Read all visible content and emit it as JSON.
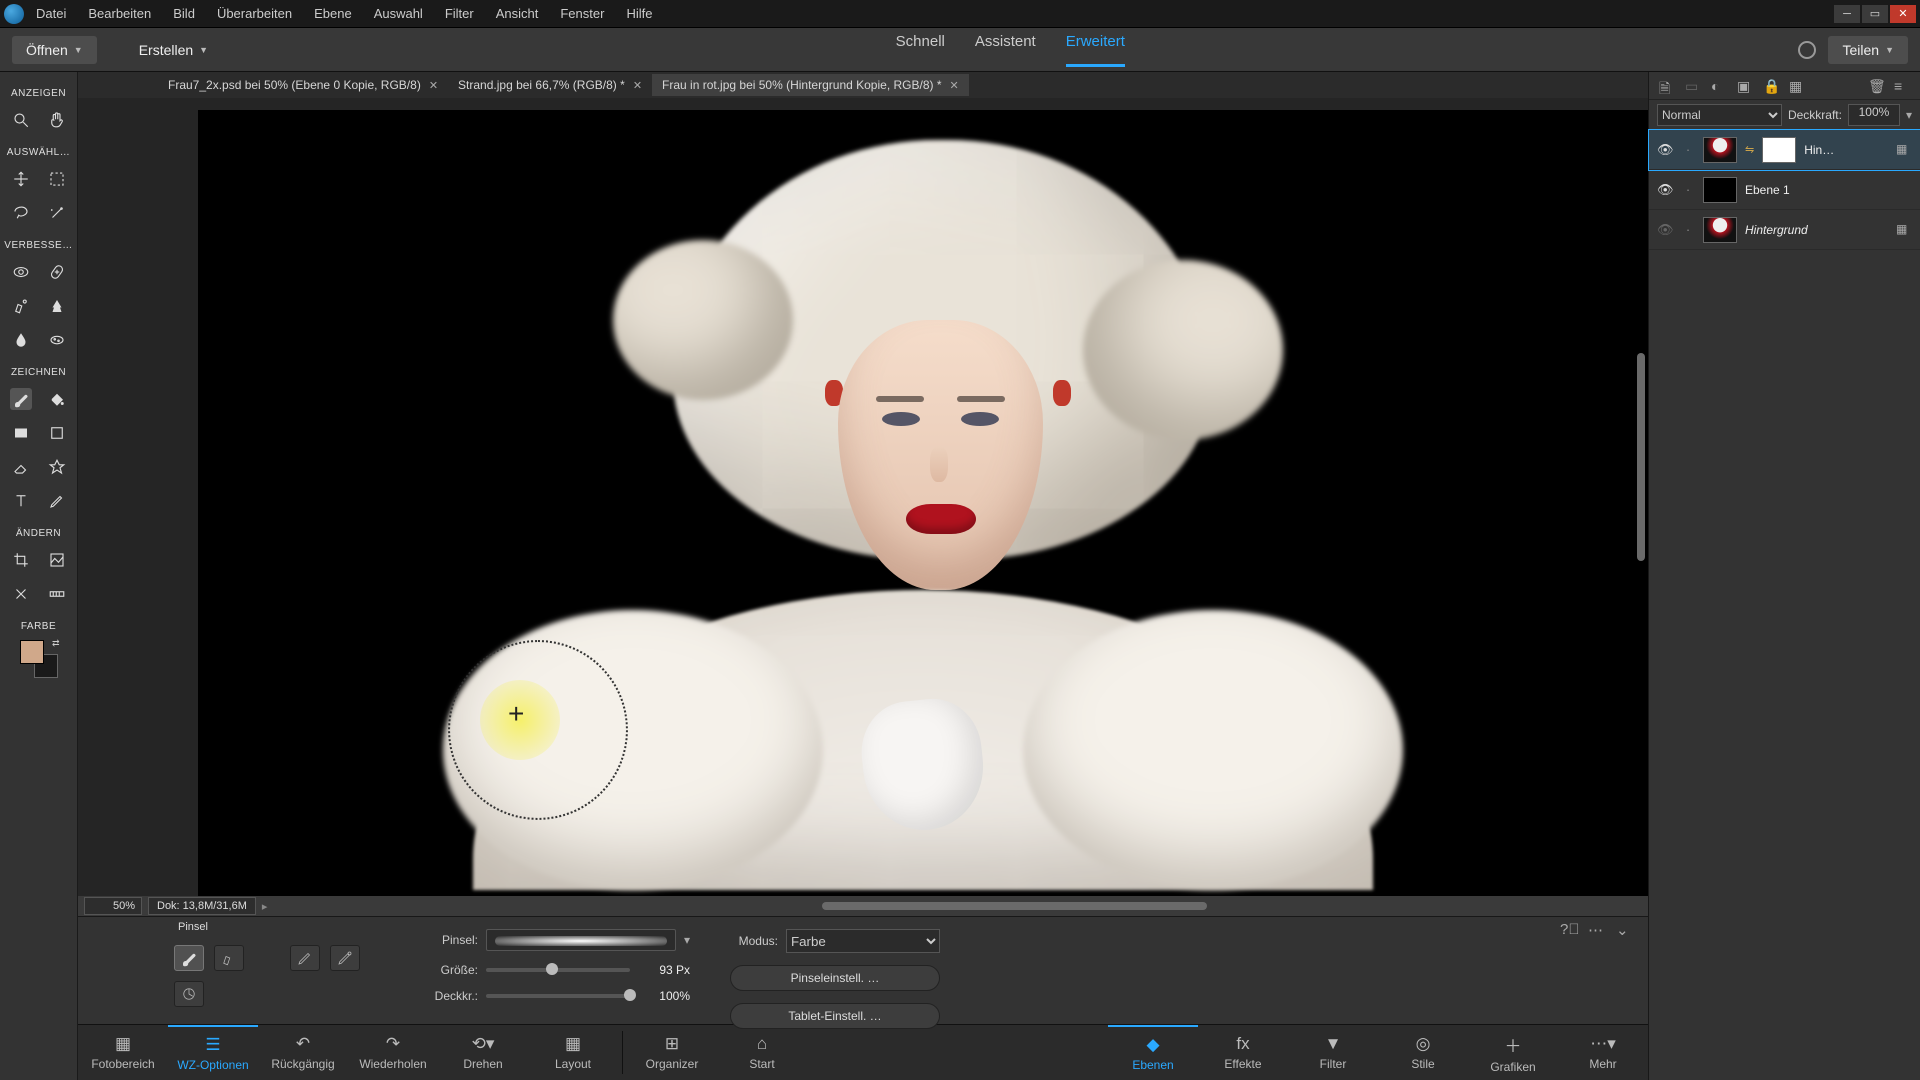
{
  "menu": {
    "items": [
      "Datei",
      "Bearbeiten",
      "Bild",
      "Überarbeiten",
      "Ebene",
      "Auswahl",
      "Filter",
      "Ansicht",
      "Fenster",
      "Hilfe"
    ]
  },
  "actions": {
    "open": "Öffnen",
    "create": "Erstellen",
    "modes": {
      "quick": "Schnell",
      "assistant": "Assistent",
      "advanced": "Erweitert"
    },
    "share": "Teilen"
  },
  "docs": [
    {
      "label": "Frau7_2x.psd bei 50% (Ebene 0 Kopie, RGB/8)",
      "active": false
    },
    {
      "label": "Strand.jpg bei 66,7% (RGB/8) *",
      "active": false
    },
    {
      "label": "Frau in rot.jpg bei 50% (Hintergrund Kopie, RGB/8) *",
      "active": true
    }
  ],
  "leftbar": {
    "sections": {
      "view": "ANZEIGEN",
      "select": "AUSWÄHL…",
      "enhance": "VERBESSE…",
      "draw": "ZEICHNEN",
      "edit": "ÄNDERN",
      "color": "FARBE"
    }
  },
  "canvas": {
    "zoom": "50%",
    "docinfo": "Dok: 13,8M/31,6M"
  },
  "rightpanel": {
    "blend": {
      "mode": "Normal",
      "opacityLabel": "Deckkraft:",
      "opacityValue": "100%"
    },
    "layers": [
      {
        "name": "Hin…",
        "visible": true,
        "hasMask": true,
        "linked": true,
        "bg": false,
        "selected": true
      },
      {
        "name": "Ebene 1",
        "visible": true,
        "hasMask": false,
        "linked": false,
        "bg": false,
        "selected": false
      },
      {
        "name": "Hintergrund",
        "visible": false,
        "hasMask": false,
        "linked": false,
        "bg": true,
        "selected": false
      }
    ]
  },
  "options": {
    "title": "Pinsel",
    "brushLabel": "Pinsel:",
    "sizeLabel": "Größe:",
    "sizeValue": "93 Px",
    "sizeKnobPct": 42,
    "opacityLabel": "Deckkr.:",
    "opacityValue": "100%",
    "opacityKnobPct": 100,
    "modeLabel": "Modus:",
    "modeValue": "Farbe",
    "brushSettings": "Pinseleinstell. …",
    "tabletSettings": "Tablet-Einstell. …"
  },
  "dock": {
    "left": [
      {
        "label": "Fotobereich"
      },
      {
        "label": "WZ-Optionen",
        "active": true
      },
      {
        "label": "Rückgängig"
      },
      {
        "label": "Wiederholen"
      },
      {
        "label": "Drehen"
      },
      {
        "label": "Layout"
      }
    ],
    "mid": [
      {
        "label": "Organizer"
      },
      {
        "label": "Start"
      }
    ],
    "right": [
      {
        "label": "Ebenen",
        "active": true
      },
      {
        "label": "Effekte"
      },
      {
        "label": "Filter"
      },
      {
        "label": "Stile"
      },
      {
        "label": "Grafiken"
      },
      {
        "label": "Mehr"
      }
    ]
  }
}
